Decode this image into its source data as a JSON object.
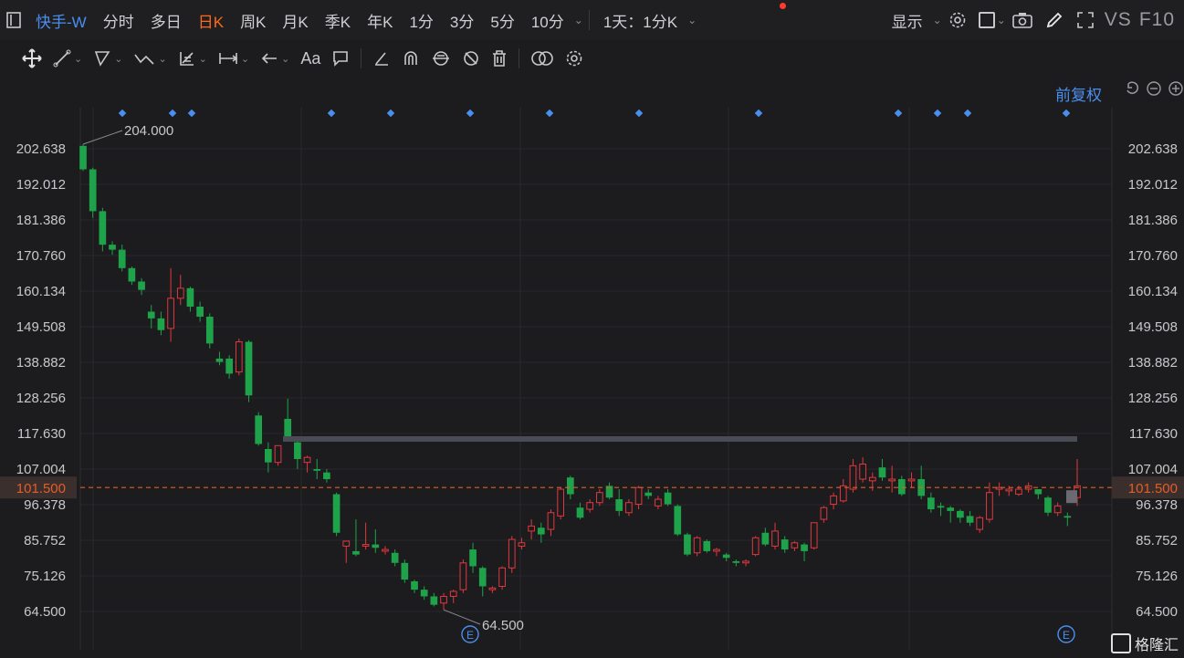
{
  "toolbar": {
    "title": "快手-W",
    "periods": [
      "分时",
      "多日",
      "日K",
      "周K",
      "月K",
      "季K",
      "年K",
      "1分",
      "3分",
      "5分",
      "10分"
    ],
    "active_period": "日K",
    "interval": "1天：1分K",
    "display": "显示",
    "vs_label": "VS",
    "f10_label": "F10"
  },
  "adjust_label": "前复权",
  "colors": {
    "up": "#e0383e",
    "down": "#1fa34a",
    "accent": "#ff6a1a",
    "price_line": "#e35d2a",
    "marker": "#4a8ef0",
    "bg": "#1c1c1e"
  },
  "watermark": "格隆汇",
  "chart_data": {
    "type": "candlestick",
    "y_ticks": [
      202.638,
      192.012,
      181.386,
      170.76,
      160.134,
      149.508,
      138.882,
      128.256,
      117.63,
      107.004,
      96.378,
      85.752,
      75.126,
      64.5
    ],
    "ylim": [
      60.0,
      212.0
    ],
    "current_price": 101.5,
    "high_label": 204.0,
    "low_label": 64.5,
    "resistance_level": 116.0,
    "event_marker": "E",
    "grid": true,
    "candles": [
      [
        203.5,
        204.0,
        196.0,
        196.5
      ],
      [
        196.5,
        197.0,
        182.0,
        184.0
      ],
      [
        184.0,
        185.0,
        172.0,
        174.0
      ],
      [
        174.0,
        175.0,
        171.0,
        172.5
      ],
      [
        172.5,
        174.0,
        166.0,
        167.0
      ],
      [
        167.0,
        167.5,
        162.0,
        163.0
      ],
      [
        163.0,
        164.0,
        159.0,
        160.5
      ],
      [
        154.0,
        156.0,
        149.0,
        152.0
      ],
      [
        152.0,
        154.0,
        147.0,
        148.5
      ],
      [
        149.0,
        167.0,
        145.0,
        158.0
      ],
      [
        158.0,
        165.0,
        156.0,
        161.0
      ],
      [
        161.0,
        161.5,
        154.0,
        155.5
      ],
      [
        155.5,
        157.0,
        151.0,
        152.5
      ],
      [
        152.5,
        153.5,
        143.0,
        144.5
      ],
      [
        140.0,
        142.0,
        138.0,
        139.0
      ],
      [
        140.0,
        141.0,
        134.0,
        135.5
      ],
      [
        136.0,
        146.0,
        135.0,
        145.0
      ],
      [
        145.0,
        145.5,
        127.0,
        129.0
      ],
      [
        123.0,
        124.0,
        114.0,
        114.5
      ],
      [
        113.0,
        115.0,
        106.0,
        109.0
      ],
      [
        109.0,
        114.0,
        108.0,
        114.0
      ],
      [
        122.0,
        128.0,
        115.5,
        116.5
      ],
      [
        115.0,
        116.0,
        107.0,
        110.0
      ],
      [
        109.0,
        111.0,
        106.0,
        110.5
      ],
      [
        107.0,
        110.0,
        104.0,
        106.5
      ],
      [
        106.0,
        107.0,
        103.0,
        104.0
      ],
      [
        99.5,
        100.0,
        87.0,
        88.0
      ],
      [
        84.0,
        85.0,
        79.0,
        85.5
      ],
      [
        82.5,
        92.0,
        81.0,
        81.5
      ],
      [
        84.0,
        91.0,
        83.0,
        84.5
      ],
      [
        84.5,
        89.0,
        82.0,
        83.5
      ],
      [
        82.5,
        84.0,
        81.5,
        83.0
      ],
      [
        82.0,
        83.0,
        78.0,
        79.0
      ],
      [
        79.0,
        80.0,
        73.0,
        74.0
      ],
      [
        73.5,
        74.0,
        70.0,
        71.0
      ],
      [
        71.0,
        72.0,
        68.0,
        69.0
      ],
      [
        69.0,
        70.0,
        66.0,
        66.5
      ],
      [
        67.0,
        70.0,
        65.0,
        69.0
      ],
      [
        69.0,
        71.0,
        67.0,
        70.5
      ],
      [
        71.0,
        80.0,
        70.0,
        79.0
      ],
      [
        83.0,
        85.0,
        76.0,
        78.0
      ],
      [
        77.5,
        78.0,
        69.0,
        72.0
      ],
      [
        71.0,
        72.0,
        70.0,
        71.5
      ],
      [
        72.0,
        78.0,
        71.0,
        77.5
      ],
      [
        77.5,
        87.0,
        76.0,
        86.0
      ],
      [
        84.0,
        86.5,
        83.0,
        85.0
      ],
      [
        88.5,
        92.0,
        86.0,
        90.0
      ],
      [
        89.5,
        91.0,
        85.0,
        87.5
      ],
      [
        89.0,
        95.0,
        87.0,
        94.0
      ],
      [
        93.0,
        101.5,
        92.0,
        101.0
      ],
      [
        104.5,
        105.0,
        98.0,
        99.5
      ],
      [
        95.5,
        97.0,
        92.0,
        92.5
      ],
      [
        95.0,
        98.0,
        94.0,
        97.0
      ],
      [
        97.0,
        101.0,
        96.0,
        100.0
      ],
      [
        102.0,
        103.0,
        98.0,
        98.5
      ],
      [
        98.0,
        101.0,
        93.0,
        94.5
      ],
      [
        94.0,
        98.0,
        93.0,
        97.0
      ],
      [
        96.5,
        102.0,
        95.0,
        101.5
      ],
      [
        100.0,
        101.0,
        98.0,
        99.0
      ],
      [
        96.0,
        99.0,
        95.0,
        98.0
      ],
      [
        100.0,
        101.0,
        96.0,
        96.5
      ],
      [
        96.0,
        96.5,
        87.0,
        87.5
      ],
      [
        87.5,
        88.0,
        81.0,
        81.5
      ],
      [
        82.0,
        87.0,
        81.0,
        86.5
      ],
      [
        85.5,
        86.0,
        82.0,
        82.5
      ],
      [
        82.5,
        83.5,
        81.0,
        83.0
      ],
      [
        81.5,
        82.0,
        79.5,
        80.5
      ],
      [
        79.5,
        80.0,
        78.0,
        79.0
      ],
      [
        79.0,
        80.0,
        78.0,
        79.5
      ],
      [
        81.5,
        87.0,
        81.0,
        86.5
      ],
      [
        88.0,
        89.5,
        84.0,
        84.5
      ],
      [
        84.0,
        91.0,
        83.0,
        88.5
      ],
      [
        86.0,
        87.0,
        82.0,
        83.0
      ],
      [
        83.5,
        85.5,
        82.5,
        85.0
      ],
      [
        84.5,
        85.0,
        79.5,
        82.5
      ],
      [
        83.5,
        91.0,
        83.0,
        91.0
      ],
      [
        92.0,
        96.0,
        91.0,
        95.5
      ],
      [
        96.5,
        100.0,
        95.0,
        99.0
      ],
      [
        97.5,
        104.0,
        97.0,
        102.0
      ],
      [
        101.0,
        110.0,
        100.0,
        108.0
      ],
      [
        104.0,
        110.5,
        103.0,
        108.5
      ],
      [
        103.5,
        106.0,
        100.5,
        104.5
      ],
      [
        107.5,
        110.0,
        103.5,
        104.5
      ],
      [
        103.5,
        108.0,
        100.0,
        104.0
      ],
      [
        104.0,
        105.0,
        99.0,
        99.5
      ],
      [
        103.5,
        106.0,
        101.5,
        104.0
      ],
      [
        104.0,
        108.0,
        98.0,
        99.0
      ],
      [
        98.5,
        100.0,
        94.0,
        95.0
      ],
      [
        96.0,
        97.0,
        93.0,
        95.5
      ],
      [
        95.5,
        96.0,
        91.0,
        94.5
      ],
      [
        94.5,
        95.0,
        91.0,
        92.5
      ],
      [
        93.0,
        94.5,
        90.0,
        91.0
      ],
      [
        89.0,
        93.0,
        88.0,
        92.5
      ],
      [
        92.0,
        103.0,
        91.0,
        100.0
      ],
      [
        101.0,
        103.0,
        99.0,
        101.5
      ],
      [
        100.5,
        102.0,
        99.0,
        101.0
      ],
      [
        99.5,
        102.0,
        99.0,
        101.0
      ],
      [
        101.0,
        103.0,
        100.0,
        102.0
      ],
      [
        101.0,
        101.0,
        98.0,
        99.5
      ],
      [
        98.5,
        99.0,
        93.0,
        94.0
      ],
      [
        94.0,
        97.0,
        93.0,
        96.0
      ],
      [
        93.0,
        94.0,
        90.0,
        92.5
      ],
      [
        98.5,
        110.0,
        96.0,
        102.0
      ]
    ]
  }
}
